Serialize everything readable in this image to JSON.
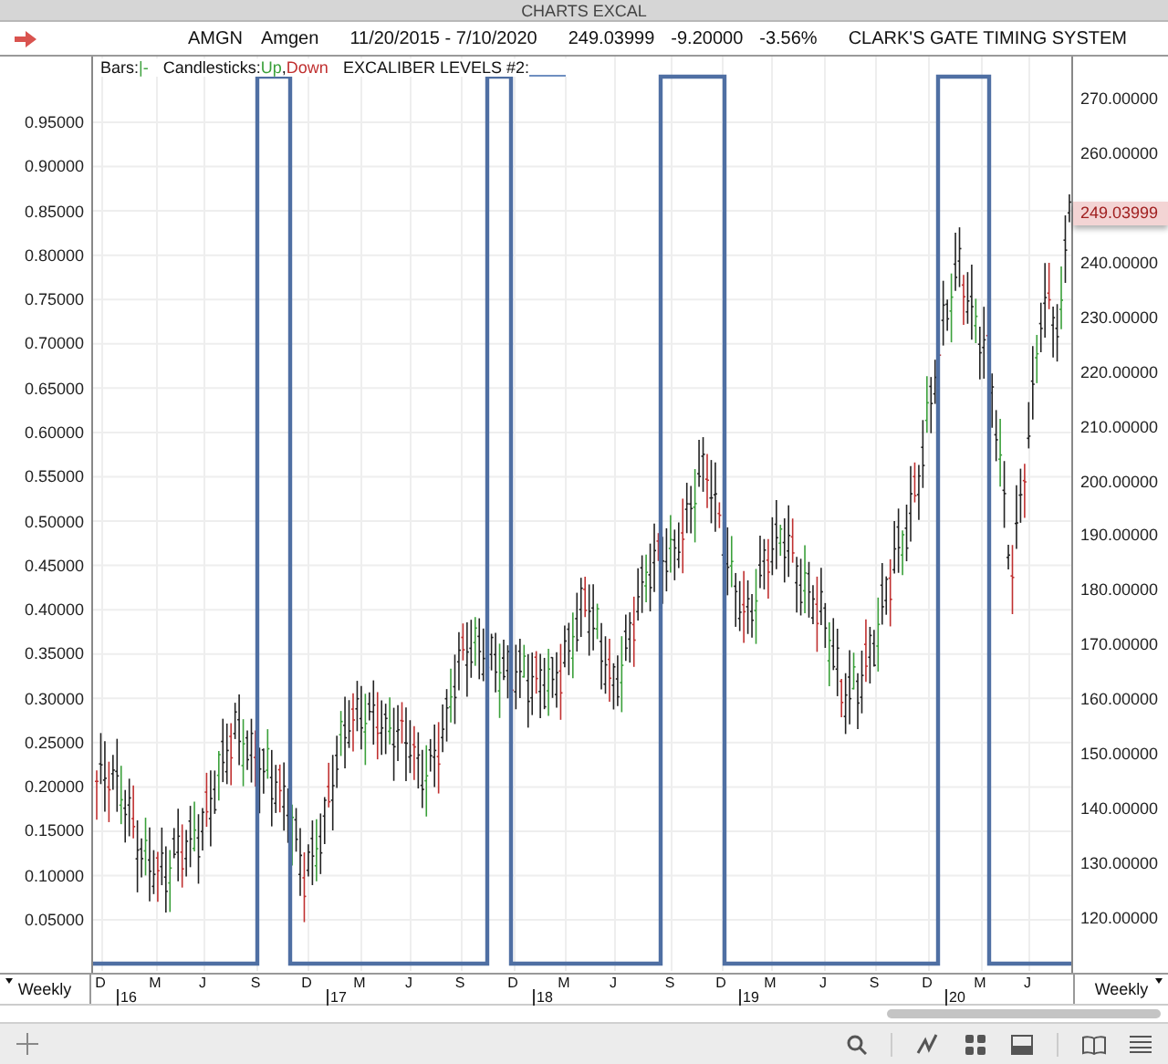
{
  "window": {
    "title": "CHARTS EXCAL"
  },
  "header": {
    "symbol": "AMGN",
    "name": "Amgen",
    "date_range": "11/20/2015 - 7/10/2020",
    "last": "249.03999",
    "change": "-9.20000",
    "change_pct": "-3.56%",
    "system": "CLARK'S GATE TIMING SYSTEM"
  },
  "legend": {
    "bars_label": "Bars:",
    "bars_symbol": "|-",
    "candles_label": "Candlesticks:",
    "up": "Up",
    "separator": ",",
    "down": "Down",
    "levels_label": "EXCALIBER LEVELS #2:"
  },
  "left_axis": [
    "0.95000",
    "0.90000",
    "0.85000",
    "0.80000",
    "0.75000",
    "0.70000",
    "0.65000",
    "0.60000",
    "0.55000",
    "0.50000",
    "0.45000",
    "0.40000",
    "0.35000",
    "0.30000",
    "0.25000",
    "0.20000",
    "0.15000",
    "0.10000",
    "0.05000"
  ],
  "right_axis": [
    "270.00000",
    "260.00000",
    "240.00000",
    "230.00000",
    "220.00000",
    "210.00000",
    "200.00000",
    "190.00000",
    "180.00000",
    "170.00000",
    "160.00000",
    "150.00000",
    "140.00000",
    "130.00000",
    "120.00000"
  ],
  "last_price_label": "249.03999",
  "months": [
    "D",
    "M",
    "J",
    "S",
    "D",
    "M",
    "J",
    "S",
    "D",
    "M",
    "J",
    "S",
    "D",
    "M",
    "J",
    "S",
    "D",
    "M",
    "J"
  ],
  "years": [
    "16",
    "17",
    "18",
    "19",
    "20"
  ],
  "timeframe_left": "Weekly",
  "timeframe_right": "Weekly"
}
